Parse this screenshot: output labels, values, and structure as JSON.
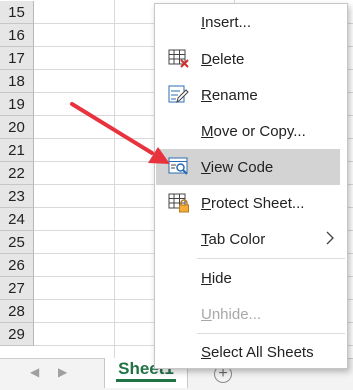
{
  "rows": [
    "15",
    "16",
    "17",
    "18",
    "19",
    "20",
    "21",
    "22",
    "23",
    "24",
    "25",
    "26",
    "27",
    "28",
    "29"
  ],
  "context_menu": {
    "insert": {
      "pre": "",
      "u": "I",
      "post": "nsert..."
    },
    "delete": {
      "pre": "",
      "u": "D",
      "post": "elete"
    },
    "rename": {
      "pre": "",
      "u": "R",
      "post": "ename"
    },
    "move_or_copy": {
      "pre": "",
      "u": "M",
      "post": "ove or Copy..."
    },
    "view_code": {
      "pre": "",
      "u": "V",
      "post": "iew Code"
    },
    "protect_sheet": {
      "pre": "",
      "u": "P",
      "post": "rotect Sheet..."
    },
    "tab_color": {
      "pre": "",
      "u": "T",
      "post": "ab Color"
    },
    "hide": {
      "pre": "",
      "u": "H",
      "post": "ide"
    },
    "unhide": {
      "pre": "",
      "u": "U",
      "post": "nhide..."
    },
    "select_all_sheets": {
      "pre": "",
      "u": "S",
      "post": "elect All Sheets"
    }
  },
  "sheet_tab": {
    "label": "Sheet1"
  },
  "nav": {
    "prev": "◀",
    "next": "▶"
  },
  "add_sheet": "+",
  "colors": {
    "accent_green": "#217346",
    "annotation_red": "#e8333f",
    "highlight": "#d3d3d3"
  }
}
